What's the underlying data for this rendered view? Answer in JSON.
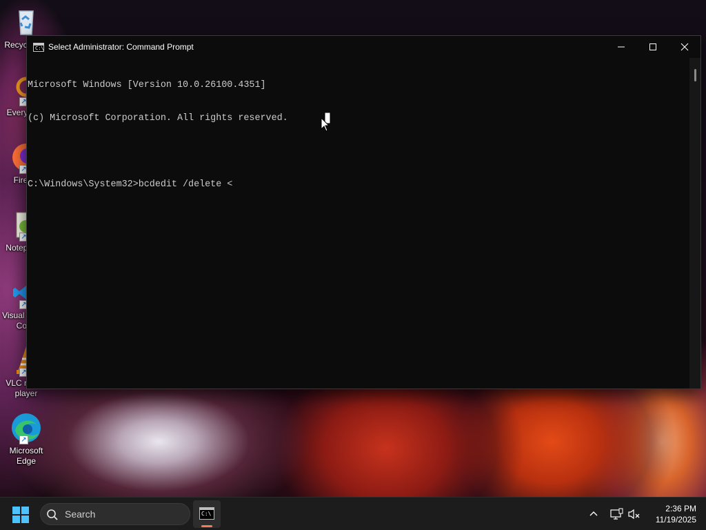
{
  "desktop": {
    "icons": [
      {
        "label": "Recycle Bin",
        "icon": "recycle-bin-icon"
      },
      {
        "label": "Everything",
        "icon": "everything-icon"
      },
      {
        "label": "Firefox",
        "icon": "firefox-icon"
      },
      {
        "label": "Notepad++",
        "icon": "notepad-plus-plus-icon"
      },
      {
        "label": "Visual Studio Code",
        "icon": "vscode-icon"
      },
      {
        "label": "VLC media player",
        "icon": "vlc-icon"
      },
      {
        "label": "Microsoft Edge",
        "icon": "edge-icon"
      }
    ]
  },
  "window": {
    "title": "Select Administrator: Command Prompt",
    "controls": {
      "minimize": "─",
      "maximize": "☐",
      "close": "✕"
    },
    "console_lines": [
      "Microsoft Windows [Version 10.0.26100.4351]",
      "(c) Microsoft Corporation. All rights reserved.",
      "",
      "C:\\Windows\\System32>bcdedit /delete <"
    ]
  },
  "taskbar": {
    "search_label": "Search",
    "clock_time": "2:36 PM",
    "clock_date": "11/19/2025",
    "accent_color": "#f57a55"
  }
}
